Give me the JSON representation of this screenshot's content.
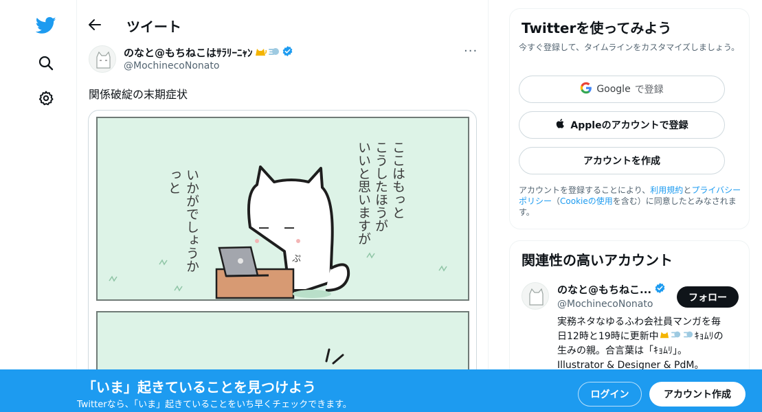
{
  "header": {
    "title": "ツイート"
  },
  "tweet": {
    "author_name": "のなと@もちねこはｻﾗﾘｰﾆｬﾝ",
    "author_handle": "@MochinecoNonato",
    "more_label": "···",
    "text": "関係破綻の末期症状",
    "comic": {
      "speech_right": [
        "ここはもっと",
        "こうしたほうが",
        "いいと思いますが"
      ],
      "speech_left": [
        "いかがでしょうか",
        "っと"
      ],
      "face_sound": "ぷ"
    }
  },
  "signup_card": {
    "title": "Twitterを使ってみよう",
    "description": "今すぐ登録して、タイムラインをカスタマイズしましょう。",
    "google_label": "Google",
    "google_suffix": "で登録",
    "apple_label": "Appleのアカウントで登録",
    "create_label": "アカウントを作成",
    "legal_prefix": "アカウントを登録することにより、",
    "terms_label": "利用規約",
    "and_label": "と",
    "privacy_label": "プライバシーポリシー",
    "open_paren": "（",
    "cookie_label": "Cookieの使用",
    "legal_suffix": "を含む）に同意したとみなされます。"
  },
  "related_card": {
    "title": "関連性の高いアカウント",
    "name": "のなと@もちねこ...",
    "handle": "@MochinecoNonato",
    "follow_label": "フォロー",
    "bio_line1": "実務ネタなゆるふわ会社員マンガを毎",
    "bio_line2": "日12時と19時に更新中",
    "bio_line2_suffix": "ｷｮﾑﾘの",
    "bio_line3": "生みの親。合言葉は「ｷｮﾑﾘ」。",
    "bio_line4": "Illustrator & Designer & PdM。"
  },
  "bottom_bar": {
    "title": "「いま」起きていることを見つけよう",
    "subtitle": "Twitterなら、「いま」起きていることをいち早くチェックできます。",
    "login_label": "ログイン",
    "signup_label": "アカウント作成"
  },
  "colors": {
    "accent": "#1d9bf0",
    "comic_bg": "#ddf3e7",
    "text": "#0f1419",
    "muted": "#536471"
  },
  "icons": [
    "twitter-logo-icon",
    "search-icon",
    "gear-icon",
    "back-arrow-icon",
    "verified-badge-icon",
    "google-icon",
    "apple-icon"
  ]
}
